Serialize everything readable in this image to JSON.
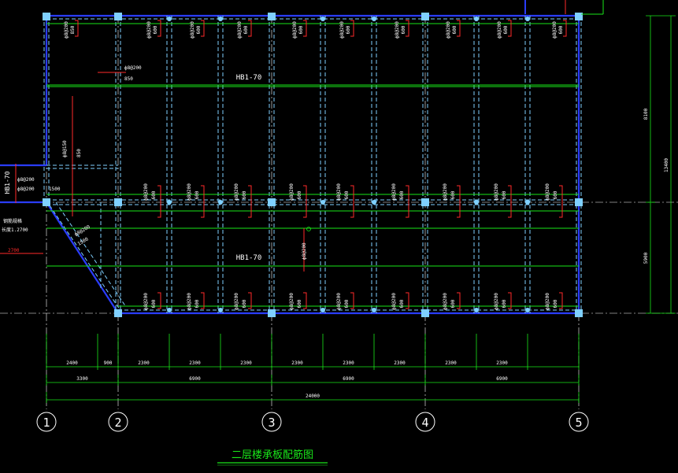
{
  "colors": {
    "background": "#000000",
    "slab_outline": "#2a3cff",
    "beam_dashed": "#7fd0ff",
    "rebar_green": "#19e619",
    "dimension": "#19e619",
    "rebar_red": "#ff2a2a",
    "label_white": "#ffffff",
    "axis_white": "#ffffff"
  },
  "title": "二层楼承板配筋图",
  "slab_labels": [
    "HB1-70",
    "HB1-70",
    "HB1-70"
  ],
  "bar_spec": "ф8@200",
  "bar_spec_variant": "ф8@150",
  "bar_length": "600",
  "bar_length_variant": "850",
  "side_dims": [
    "8100",
    "5900",
    "13400"
  ],
  "left_labels": [
    "ф8@200",
    "ф8@200",
    "1500",
    "钢筋规格",
    "长度1.2700",
    "2700"
  ],
  "left_misc": [
    "850",
    "ф8@200",
    "ф8@150",
    "850"
  ],
  "dim_row1": [
    "2400",
    "900",
    "2300",
    "2300",
    "2300",
    "2300",
    "2300",
    "2300",
    "2300",
    "2300"
  ],
  "dim_row2": [
    "3300",
    "6900",
    "6900",
    "6900"
  ],
  "dim_total": "24000",
  "axes": [
    "1",
    "2",
    "3",
    "4",
    "5"
  ]
}
